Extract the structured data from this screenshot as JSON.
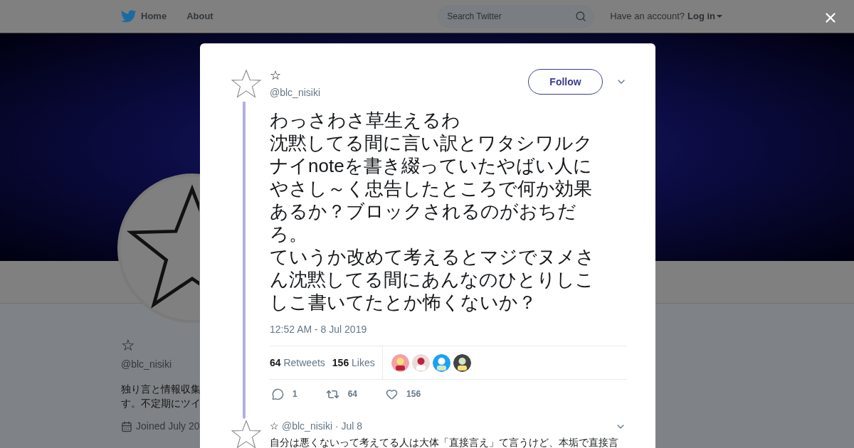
{
  "header": {
    "nav": [
      "Home",
      "About"
    ],
    "search": {
      "placeholder": "Search Twitter"
    },
    "account_prompt": "Have an account?",
    "login": "Log in"
  },
  "profile": {
    "name": "☆",
    "handle": "@blc_nisiki",
    "bio": [
      "独り言と情報収集",
      "す。不定期にツイ"
    ],
    "joined": "Joined July 20"
  },
  "tweet": {
    "name": "☆",
    "handle": "@blc_nisiki",
    "follow": "Follow",
    "paragraphs": [
      "わっさわさ草生えるわ",
      "沈黙してる間に言い訳とワタシワルクナイnoteを書き綴っていたやばい人にやさし～く忠告したところで何か効果あるか？ブロックされるのがおちだろ。",
      "ていうか改めて考えるとマジでヌメさん沈黙してる間にあんなのひとりしこしこ書いてたとか怖くないか？"
    ],
    "timestamp": "12:52 AM - 8 Jul 2019",
    "stats": [
      {
        "count": "64",
        "label": "Retweets"
      },
      {
        "count": "156",
        "label": "Likes"
      }
    ],
    "likers": [
      {
        "kind": "picture"
      },
      {
        "kind": "picture"
      },
      {
        "kind": "picture"
      },
      {
        "kind": "picture"
      }
    ],
    "actions": [
      {
        "kind": "reply",
        "count": "1"
      },
      {
        "kind": "retweet",
        "count": "64"
      },
      {
        "kind": "like",
        "count": "156"
      }
    ]
  },
  "reply": {
    "name": "☆",
    "handle": "@blc_nisiki",
    "date": "· Jul 8",
    "text": "自分は悪くないって考えてる人は大体「直接言え」て言うけど、本垢で直接言"
  }
}
